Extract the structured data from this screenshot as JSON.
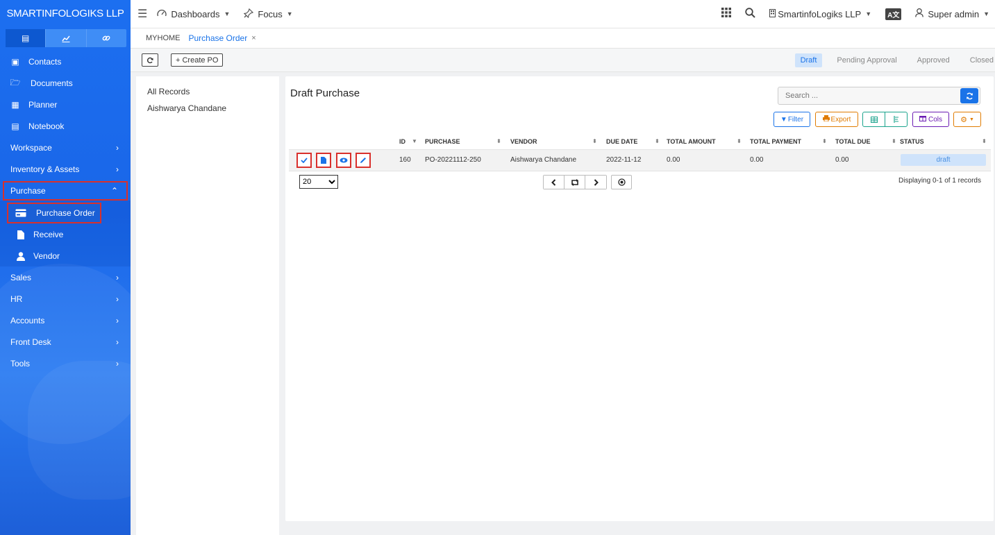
{
  "brand": {
    "name": "SMARTINFOLOGIKS LLP"
  },
  "sidebar": {
    "tabs": [
      {
        "icon": "id-card-icon",
        "glyph": "▤"
      },
      {
        "icon": "chart-icon",
        "glyph": "📈"
      },
      {
        "icon": "link-icon",
        "glyph": "🔗"
      }
    ],
    "items": [
      {
        "label": "Contacts",
        "glyph": "▣"
      },
      {
        "label": "Documents",
        "glyph": "🗁"
      },
      {
        "label": "Planner",
        "glyph": "▦"
      },
      {
        "label": "Notebook",
        "glyph": "▤"
      }
    ],
    "sections": [
      "Workspace",
      "Inventory & Assets"
    ],
    "open_section": "Purchase",
    "sub_items": [
      {
        "label": "Purchase Order",
        "glyph": "▬"
      },
      {
        "label": "Receive",
        "glyph": "▮"
      },
      {
        "label": "Vendor",
        "glyph": "●"
      }
    ],
    "sections_after": [
      "Sales",
      "HR",
      "Accounts",
      "Front Desk",
      "Tools"
    ]
  },
  "topbar": {
    "dashboards": "Dashboards",
    "focus": "Focus",
    "company": "SmartinfoLogiks LLP",
    "lang": "A文",
    "user": "Super admin"
  },
  "breadcrumb": {
    "home": "MYHOME",
    "tab": "Purchase Order",
    "close": "×"
  },
  "toolbar": {
    "create_po": "+ Create PO",
    "status_tabs": [
      "Draft",
      "Pending Approval",
      "Approved",
      "Closed"
    ],
    "active_status": "Draft"
  },
  "records": {
    "items": [
      "All Records",
      "Aishwarya Chandane"
    ]
  },
  "main": {
    "title": "Draft Purchase",
    "search_placeholder": "Search ...",
    "filter": "Filter",
    "export": "Export",
    "cols": "Cols"
  },
  "table": {
    "columns": [
      "ID",
      "PURCHASE",
      "VENDOR",
      "DUE DATE",
      "TOTAL AMOUNT",
      "TOTAL PAYMENT",
      "TOTAL DUE",
      "STATUS"
    ],
    "rows": [
      {
        "id": "160",
        "purchase": "PO-20221112-250",
        "vendor": "Aishwarya Chandane",
        "due_date": "2022-11-12",
        "total_amount": "0.00",
        "total_payment": "0.00",
        "total_due": "0.00",
        "status": "draft"
      }
    ]
  },
  "pagination": {
    "page_size": "20",
    "page_size_options": [
      "20"
    ],
    "display": "Displaying 0-1 of 1 records"
  },
  "colors": {
    "accent": "#1a73e8",
    "sidebar": "#1c6ff0",
    "highlight": "#d9302c"
  }
}
